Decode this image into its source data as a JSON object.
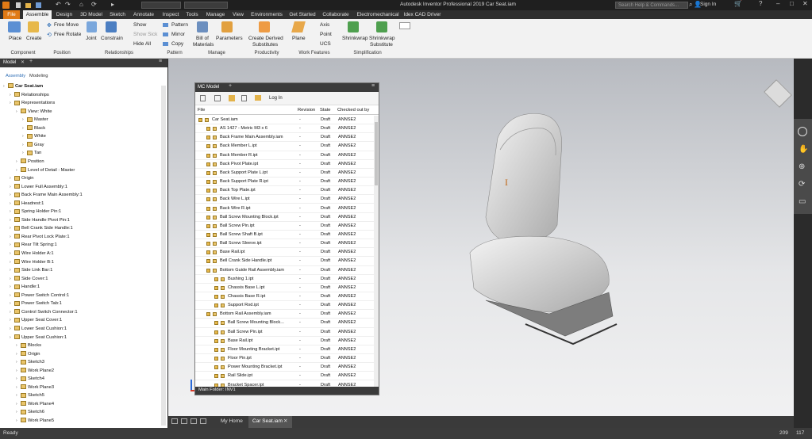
{
  "titlebar": {
    "file_label": "File",
    "app_title": "Autodesk Inventor Professional 2019    Car Seat.iam",
    "search_placeholder": "Search Help & Commands...",
    "sign_in": "Sign In"
  },
  "tabs": [
    "File",
    "Assemble",
    "Design",
    "3D Model",
    "Sketch",
    "Annotate",
    "Inspect",
    "Tools",
    "Manage",
    "View",
    "Environments",
    "Get Started",
    "Collaborate",
    "Electromechanical",
    "Idex CAD Driver"
  ],
  "ribbon": {
    "place": "Place",
    "create": "Create",
    "free_move": "Free Move",
    "free_rotate": "Free Rotate",
    "joint": "Joint",
    "constrain": "Constrain",
    "show": "Show",
    "show_sick": "Show Sick",
    "hide_all": "Hide All",
    "pattern": "Pattern",
    "mirror": "Mirror",
    "copy": "Copy",
    "bill_of": "Bill of",
    "materials": "Materials",
    "parameters": "Parameters",
    "create_derived": "Create Derived",
    "substitutes": "Substitutes",
    "plane": "Plane",
    "axis": "Axis",
    "point": "Point",
    "ucs": "UCS",
    "shrinkwrap": "Shrinkwrap",
    "shrinkwrap2": "Shrinkwrap",
    "substitute": "Substitute",
    "groups": {
      "component": "Component",
      "position": "Position",
      "relationships": "Relationships",
      "pattern": "Pattern",
      "manage": "Manage",
      "productivity": "Productivity",
      "work_features": "Work Features",
      "simplification": "Simplification"
    }
  },
  "left_panel": {
    "model_tab": "Model",
    "assembly": "Assembly",
    "modeling": "Modeling",
    "tree": [
      {
        "label": "Car Seat.iam",
        "depth": 0,
        "bold": true
      },
      {
        "label": "Relationships",
        "depth": 1
      },
      {
        "label": "Representations",
        "depth": 1
      },
      {
        "label": "View: White",
        "depth": 2
      },
      {
        "label": "Master",
        "depth": 3
      },
      {
        "label": "Black",
        "depth": 3
      },
      {
        "label": "White",
        "depth": 3
      },
      {
        "label": "Gray",
        "depth": 3
      },
      {
        "label": "Tan",
        "depth": 3
      },
      {
        "label": "Position",
        "depth": 2
      },
      {
        "label": "Level of Detail : Master",
        "depth": 2
      },
      {
        "label": "Origin",
        "depth": 1
      },
      {
        "label": "Lower Full Assembly:1",
        "depth": 1
      },
      {
        "label": "Back Frame Main Assembly:1",
        "depth": 1
      },
      {
        "label": "Headrest:1",
        "depth": 1
      },
      {
        "label": "Spring Holder Pin:1",
        "depth": 1
      },
      {
        "label": "Side Handle Pivot Pin:1",
        "depth": 1
      },
      {
        "label": "Bell Crank Side Handle:1",
        "depth": 1
      },
      {
        "label": "Rear Pivot Lock Plate:1",
        "depth": 1
      },
      {
        "label": "Rear Tilt Spring:1",
        "depth": 1
      },
      {
        "label": "Wire Holder A:1",
        "depth": 1
      },
      {
        "label": "Wire Holder B:1",
        "depth": 1
      },
      {
        "label": "Side Link Bar:1",
        "depth": 1
      },
      {
        "label": "Side Cover:1",
        "depth": 1
      },
      {
        "label": "Handle:1",
        "depth": 1
      },
      {
        "label": "Power Switch Control:1",
        "depth": 1
      },
      {
        "label": "Power Switch Tab:1",
        "depth": 1
      },
      {
        "label": "Control Switch Connector:1",
        "depth": 1
      },
      {
        "label": "Upper Seat Cover:1",
        "depth": 1
      },
      {
        "label": "Lower Seat Cushion:1",
        "depth": 1
      },
      {
        "label": "Upper Seat Cushion:1",
        "depth": 1
      },
      {
        "label": "Blocks",
        "depth": 2
      },
      {
        "label": "Origin",
        "depth": 2
      },
      {
        "label": "Sketch3",
        "depth": 2
      },
      {
        "label": "Work Plane2",
        "depth": 2
      },
      {
        "label": "Sketch4",
        "depth": 2
      },
      {
        "label": "Work Plane3",
        "depth": 2
      },
      {
        "label": "Sketch5",
        "depth": 2
      },
      {
        "label": "Work Plane4",
        "depth": 2
      },
      {
        "label": "Sketch6",
        "depth": 2
      },
      {
        "label": "Work Plane5",
        "depth": 2
      }
    ]
  },
  "mc_panel": {
    "title": "MC Model",
    "log_in": "Log In",
    "headers": [
      "File",
      "Revision",
      "State",
      "Checked out by"
    ],
    "rows": [
      {
        "file": "Car Seat.iam",
        "rev": "-",
        "state": "Draft",
        "by": "ANNSE2",
        "depth": 0
      },
      {
        "file": "AS 1427 - Metric M3 x 6",
        "rev": "-",
        "state": "Draft",
        "by": "ANNSE2",
        "depth": 1
      },
      {
        "file": "Back Frame Main Assembly.iam",
        "rev": "-",
        "state": "Draft",
        "by": "ANNSE2",
        "depth": 1
      },
      {
        "file": "Back Member L.ipt",
        "rev": "-",
        "state": "Draft",
        "by": "ANNSE2",
        "depth": 1
      },
      {
        "file": "Back Member R.ipt",
        "rev": "-",
        "state": "Draft",
        "by": "ANNSE2",
        "depth": 1
      },
      {
        "file": "Back Pivot Plate.ipt",
        "rev": "-",
        "state": "Draft",
        "by": "ANNSE2",
        "depth": 1
      },
      {
        "file": "Back Support Plate L.ipt",
        "rev": "-",
        "state": "Draft",
        "by": "ANNSE2",
        "depth": 1
      },
      {
        "file": "Back Support Plate R.ipt",
        "rev": "-",
        "state": "Draft",
        "by": "ANNSE2",
        "depth": 1
      },
      {
        "file": "Back Top Plate.ipt",
        "rev": "-",
        "state": "Draft",
        "by": "ANNSE2",
        "depth": 1
      },
      {
        "file": "Back Wire L.ipt",
        "rev": "-",
        "state": "Draft",
        "by": "ANNSE2",
        "depth": 1
      },
      {
        "file": "Back Wire R.ipt",
        "rev": "-",
        "state": "Draft",
        "by": "ANNSE2",
        "depth": 1
      },
      {
        "file": "Ball Screw Mounting Block.ipt",
        "rev": "-",
        "state": "Draft",
        "by": "ANNSE2",
        "depth": 1
      },
      {
        "file": "Ball Screw Pin.ipt",
        "rev": "-",
        "state": "Draft",
        "by": "ANNSE2",
        "depth": 1
      },
      {
        "file": "Ball Screw Shaft B.ipt",
        "rev": "-",
        "state": "Draft",
        "by": "ANNSE2",
        "depth": 1
      },
      {
        "file": "Ball Screw Sleeve.ipt",
        "rev": "-",
        "state": "Draft",
        "by": "ANNSE2",
        "depth": 1
      },
      {
        "file": "Base Rail.ipt",
        "rev": "-",
        "state": "Draft",
        "by": "ANNSE2",
        "depth": 1
      },
      {
        "file": "Bell Crank Side Handle.ipt",
        "rev": "-",
        "state": "Draft",
        "by": "ANNSE2",
        "depth": 1
      },
      {
        "file": "Bottom Guide Rail Assembly.iam",
        "rev": "-",
        "state": "Draft",
        "by": "ANNSE2",
        "depth": 1
      },
      {
        "file": "Bushing 1.ipt",
        "rev": "-",
        "state": "Draft",
        "by": "ANNSE2",
        "depth": 2
      },
      {
        "file": "Chassis Base L.ipt",
        "rev": "-",
        "state": "Draft",
        "by": "ANNSE2",
        "depth": 2
      },
      {
        "file": "Chassis Base R.ipt",
        "rev": "-",
        "state": "Draft",
        "by": "ANNSE2",
        "depth": 2
      },
      {
        "file": "Support Rod.ipt",
        "rev": "-",
        "state": "Draft",
        "by": "ANNSE2",
        "depth": 2
      },
      {
        "file": "Bottom Rail Assembly.iam",
        "rev": "-",
        "state": "Draft",
        "by": "ANNSE2",
        "depth": 1
      },
      {
        "file": "Ball Screw Mounting Block...",
        "rev": "-",
        "state": "Draft",
        "by": "ANNSE2",
        "depth": 2
      },
      {
        "file": "Ball Screw Pin.ipt",
        "rev": "-",
        "state": "Draft",
        "by": "ANNSE2",
        "depth": 2
      },
      {
        "file": "Base Rail.ipt",
        "rev": "-",
        "state": "Draft",
        "by": "ANNSE2",
        "depth": 2
      },
      {
        "file": "Floor Mounting Bracket.ipt",
        "rev": "-",
        "state": "Draft",
        "by": "ANNSE2",
        "depth": 2
      },
      {
        "file": "Floor Pin.ipt",
        "rev": "-",
        "state": "Draft",
        "by": "ANNSE2",
        "depth": 2
      },
      {
        "file": "Power Mounting Bracket.ipt",
        "rev": "-",
        "state": "Draft",
        "by": "ANNSE2",
        "depth": 2
      },
      {
        "file": "Rail Slide.ipt",
        "rev": "-",
        "state": "Draft",
        "by": "ANNSE2",
        "depth": 2
      },
      {
        "file": "Bracket Spacer.ipt",
        "rev": "-",
        "state": "Draft",
        "by": "ANNSE2",
        "depth": 2
      }
    ],
    "footer": "Main Folder: INV1"
  },
  "doc_tabs": {
    "home": "My Home",
    "file": "Car Seat.iam"
  },
  "status": {
    "text": "Ready",
    "num1": "209",
    "num2": "117"
  },
  "colors": {
    "accent": "#e07a16",
    "ribbon_bg": "#f2f2f2",
    "title_bg": "#1f1f1f"
  }
}
